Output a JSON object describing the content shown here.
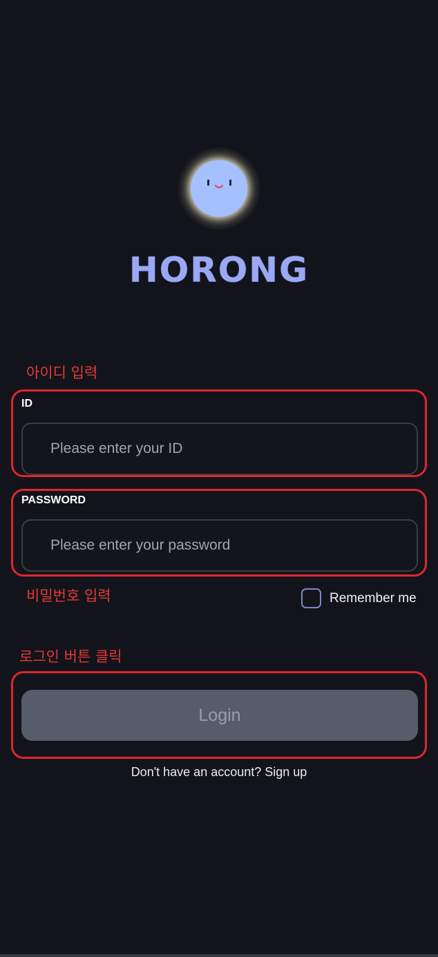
{
  "app": {
    "title": "HORONG"
  },
  "logo": {
    "icon_name": "smiling-moon-icon",
    "ball_color": "#a4c0ff"
  },
  "annotations": {
    "id_note": "아이디 입력",
    "password_note": "비밀번호 입력",
    "login_note": "로그인 버튼 클릭",
    "color": "#e53935"
  },
  "form": {
    "id_label": "ID",
    "id_placeholder": "Please enter your ID",
    "id_value": "",
    "password_label": "PASSWORD",
    "password_placeholder": "Please enter your password",
    "password_value": "",
    "remember_label": "Remember me",
    "remember_checked": false,
    "login_label": "Login",
    "signup_prompt": "Don't have an account? Sign up"
  },
  "colors": {
    "background": "#13141b",
    "title": "#9aa8f5",
    "button": "#575b6a",
    "checkbox_border": "#7d86c8"
  }
}
